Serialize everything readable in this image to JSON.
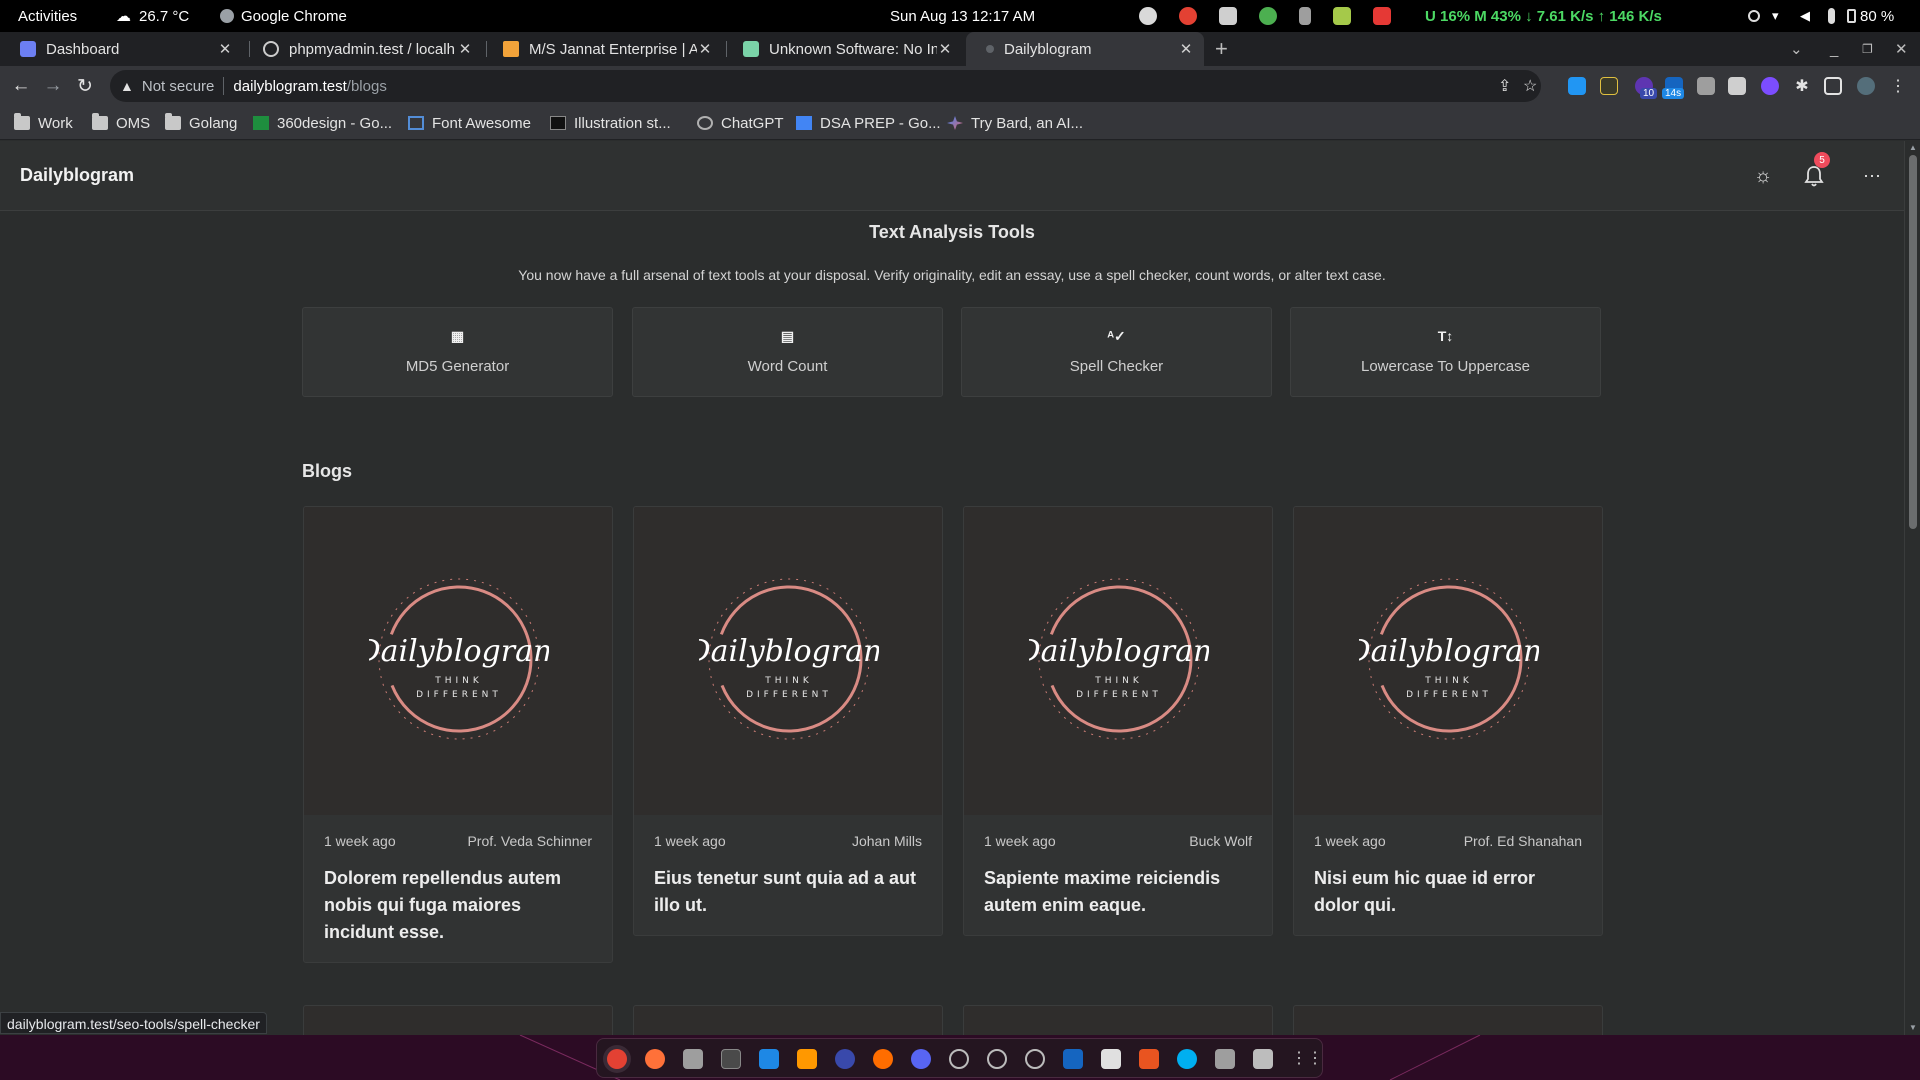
{
  "system_bar": {
    "activities": "Activities",
    "weather": "26.7 °C",
    "app_name": "Google Chrome",
    "datetime": "Sun Aug 13  12:17 AM",
    "stats": {
      "u_label": "U",
      "u_value": "16%",
      "m_label": "M",
      "m_value": "43%",
      "down": "↓ 7.61 K/s",
      "up": "↑  146 K/s"
    },
    "battery": "80 %"
  },
  "tabs": [
    {
      "title": "Dashboard",
      "color": "#6c7ff2"
    },
    {
      "title": "phpmyadmin.test / localh",
      "color": "#e3e3e3"
    },
    {
      "title": "M/S Jannat Enterprise | A",
      "color": "#f2a33a"
    },
    {
      "title": "Unknown Software: No In",
      "color": "#7ad3a8"
    },
    {
      "title": "Dailyblogram",
      "color": "#8a8a8a"
    }
  ],
  "address_bar": {
    "security": "Not secure",
    "host": "dailyblogram.test",
    "path": "/blogs"
  },
  "extensions": {
    "badge_1": "10",
    "badge_2": "14s"
  },
  "bookmarks": [
    {
      "label": "Work"
    },
    {
      "label": "OMS"
    },
    {
      "label": "Golang"
    },
    {
      "label": "360design - Go..."
    },
    {
      "label": "Font Awesome"
    },
    {
      "label": "Illustration st..."
    },
    {
      "label": "ChatGPT"
    },
    {
      "label": "DSA PREP - Go..."
    },
    {
      "label": "Try Bard, an AI..."
    }
  ],
  "app": {
    "brand": "Dailyblogram",
    "notification_count": "5",
    "tools_title": "Text Analysis Tools",
    "tools_description": "You now have a full arsenal of text tools at your disposal. Verify originality, edit an essay, use a spell checker, count words, or alter text case.",
    "tools": [
      {
        "label": "MD5 Generator",
        "icon": "grid-icon"
      },
      {
        "label": "Word Count",
        "icon": "document-icon"
      },
      {
        "label": "Spell Checker",
        "icon": "spellcheck-icon"
      },
      {
        "label": "Lowercase To Uppercase",
        "icon": "text-case-icon"
      }
    ],
    "blogs_heading": "Blogs",
    "blog_logo": {
      "script": "Dailyblogram",
      "tagline_1": "THINK",
      "tagline_2": "DIFFERENT"
    },
    "blogs": [
      {
        "time": "1 week ago",
        "author": "Prof. Veda Schinner",
        "title": "Dolorem repellendus autem nobis qui fuga maiores incidunt esse."
      },
      {
        "time": "1 week ago",
        "author": "Johan Mills",
        "title": "Eius tenetur sunt quia ad a aut illo ut."
      },
      {
        "time": "1 week ago",
        "author": "Buck Wolf",
        "title": "Sapiente maxime reiciendis autem enim eaque."
      },
      {
        "time": "1 week ago",
        "author": "Prof. Ed Shanahan",
        "title": "Nisi eum hic quae id error dolor qui."
      }
    ]
  },
  "status_bar_url": "dailyblogram.test/seo-tools/spell-checker",
  "colors": {
    "page_bg": "#2b2d2d",
    "card_bg": "#323434",
    "logo_ring": "#d98b84",
    "badge": "#ef4b5c",
    "dock_bg": "#2c0b24"
  }
}
